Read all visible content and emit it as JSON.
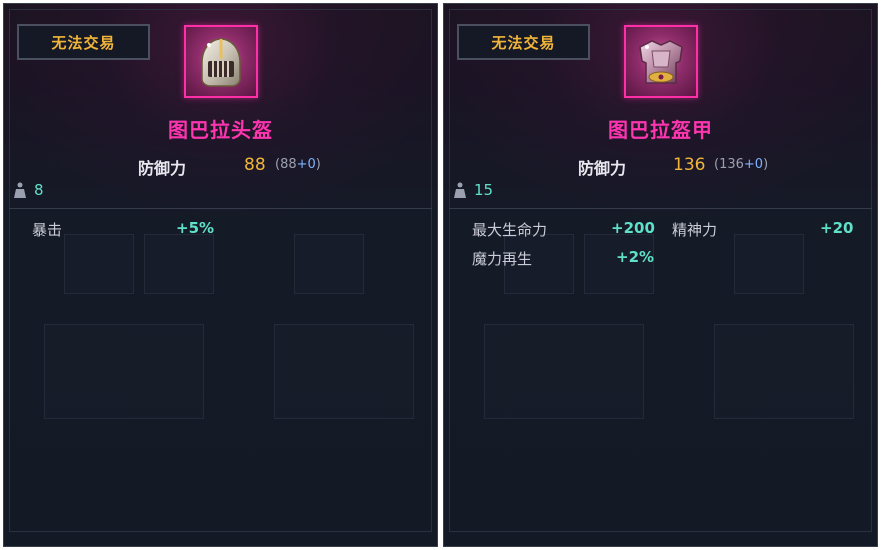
{
  "colors": {
    "tag_text": "#f2b53a",
    "item_name": "#ff35b0",
    "defense_value": "#f2b53a",
    "option_value": "#5fe0c8",
    "icon_border": "#ff2fa8"
  },
  "panels": [
    {
      "tag": "无法交易",
      "icon": "pink-helmet-icon",
      "name": "图巴拉头盔",
      "defense_label": "防御力",
      "defense_value": "88",
      "defense_base_open": "(88",
      "defense_plus": "+0",
      "defense_close": ")",
      "weight": "8",
      "options": [
        {
          "label": "暴击",
          "value": "+5%"
        }
      ]
    },
    {
      "tag": "无法交易",
      "icon": "pink-armor-icon",
      "name": "图巴拉盔甲",
      "defense_label": "防御力",
      "defense_value": "136",
      "defense_base_open": "(136",
      "defense_plus": "+0",
      "defense_close": ")",
      "weight": "15",
      "options": [
        {
          "label": "最大生命力",
          "value": "+200"
        },
        {
          "label": "精神力",
          "value": "+20"
        },
        {
          "label": "魔力再生",
          "value": "+2%"
        }
      ]
    }
  ]
}
